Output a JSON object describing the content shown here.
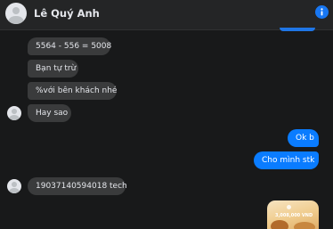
{
  "header": {
    "contact_name": "Lê Quý Anh"
  },
  "messages": {
    "m1": "5564 - 556 = 5008",
    "m2": "Bạn tự trừ",
    "m3": "%với bên khách nhé",
    "m4": "Hay sao",
    "m5": "Ok b",
    "m6": "Cho mình stk",
    "m7": "19037140594018 tech"
  },
  "image_message": {
    "caption": "3,008,000 VND"
  },
  "icons": {
    "info": "info-icon",
    "avatar": "person-avatar"
  },
  "colors": {
    "background": "#18191a",
    "incoming_bubble": "#3a3b3c",
    "outgoing_bubble": "#0a7cff",
    "accent": "#1877f2"
  }
}
